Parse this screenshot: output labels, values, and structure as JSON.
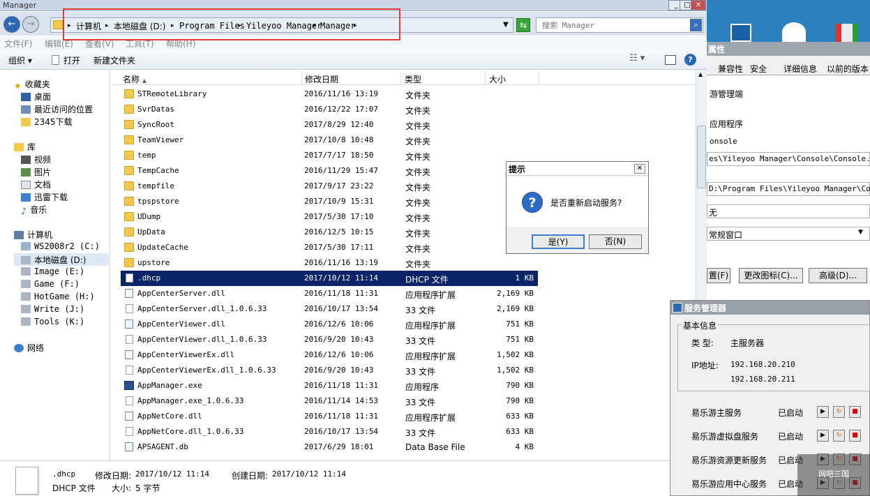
{
  "window": {
    "title": "Manager"
  },
  "address": {
    "segments": [
      "计算机",
      "本地磁盘 (D:)",
      "Program Files",
      "Yileyoo Manager",
      "Manager"
    ],
    "search_placeholder": "搜索 Manager"
  },
  "menu": [
    "文件(F)",
    "编辑(E)",
    "查看(V)",
    "工具(T)",
    "帮助(H)"
  ],
  "toolbar": {
    "organize": "组织",
    "open": "打开",
    "new_folder": "新建文件夹"
  },
  "nav": {
    "favorites": "收藏夹",
    "fav_items": [
      "桌面",
      "最近访问的位置",
      "2345下载"
    ],
    "libraries": "库",
    "lib_items": [
      "视频",
      "图片",
      "文档",
      "迅雷下载",
      "音乐"
    ],
    "computer": "计算机",
    "drives": [
      "WS2008r2 (C:)",
      "本地磁盘 (D:)",
      "Image (E:)",
      "Game (F:)",
      "HotGame (H:)",
      "Write (J:)",
      "Tools (K:)"
    ],
    "network": "网络"
  },
  "columns": {
    "name": "名称",
    "date": "修改日期",
    "type": "类型",
    "size": "大小"
  },
  "files": [
    {
      "name": "STRemoteLibrary",
      "date": "2016/11/16 13:19",
      "type": "文件夹",
      "size": "",
      "icon": "folder"
    },
    {
      "name": "SvrDatas",
      "date": "2016/12/22 17:07",
      "type": "文件夹",
      "size": "",
      "icon": "folder"
    },
    {
      "name": "SyncRoot",
      "date": "2017/8/29 12:40",
      "type": "文件夹",
      "size": "",
      "icon": "folder"
    },
    {
      "name": "TeamViewer",
      "date": "2017/10/8 10:48",
      "type": "文件夹",
      "size": "",
      "icon": "folder"
    },
    {
      "name": "temp",
      "date": "2017/7/17 18:50",
      "type": "文件夹",
      "size": "",
      "icon": "folder"
    },
    {
      "name": "TempCache",
      "date": "2016/11/29 15:47",
      "type": "文件夹",
      "size": "",
      "icon": "folder"
    },
    {
      "name": "tempfile",
      "date": "2017/9/17 23:22",
      "type": "文件夹",
      "size": "",
      "icon": "folder"
    },
    {
      "name": "tpspstore",
      "date": "2017/10/9 15:31",
      "type": "文件夹",
      "size": "",
      "icon": "folder"
    },
    {
      "name": "UDump",
      "date": "2017/5/30 17:10",
      "type": "文件夹",
      "size": "",
      "icon": "folder"
    },
    {
      "name": "UpData",
      "date": "2016/12/5 10:15",
      "type": "文件夹",
      "size": "",
      "icon": "folder"
    },
    {
      "name": "UpdateCache",
      "date": "2017/5/30 17:11",
      "type": "文件夹",
      "size": "",
      "icon": "folder"
    },
    {
      "name": "upstore",
      "date": "2016/11/16 13:19",
      "type": "文件夹",
      "size": "",
      "icon": "folder"
    },
    {
      "name": ".dhcp",
      "date": "2017/10/12 11:14",
      "type": "DHCP 文件",
      "size": "1 KB",
      "icon": "file"
    },
    {
      "name": "AppCenterServer.dll",
      "date": "2016/11/18 11:31",
      "type": "应用程序扩展",
      "size": "2,169 KB",
      "icon": "dll"
    },
    {
      "name": "AppCenterServer.dll_1.0.6.33",
      "date": "2016/10/17 13:54",
      "type": "33 文件",
      "size": "2,169 KB",
      "icon": "file"
    },
    {
      "name": "AppCenterViewer.dll",
      "date": "2016/12/6 10:06",
      "type": "应用程序扩展",
      "size": "751 KB",
      "icon": "dll"
    },
    {
      "name": "AppCenterViewer.dll_1.0.6.33",
      "date": "2016/9/20 10:43",
      "type": "33 文件",
      "size": "751 KB",
      "icon": "file"
    },
    {
      "name": "AppCenterViewerEx.dll",
      "date": "2016/12/6 10:06",
      "type": "应用程序扩展",
      "size": "1,502 KB",
      "icon": "dll"
    },
    {
      "name": "AppCenterViewerEx.dll_1.0.6.33",
      "date": "2016/9/20 10:43",
      "type": "33 文件",
      "size": "1,502 KB",
      "icon": "file"
    },
    {
      "name": "AppManager.exe",
      "date": "2016/11/18 11:31",
      "type": "应用程序",
      "size": "790 KB",
      "icon": "exe"
    },
    {
      "name": "AppManager.exe_1.0.6.33",
      "date": "2016/11/14 14:53",
      "type": "33 文件",
      "size": "790 KB",
      "icon": "file"
    },
    {
      "name": "AppNetCore.dll",
      "date": "2016/11/18 11:31",
      "type": "应用程序扩展",
      "size": "633 KB",
      "icon": "dll"
    },
    {
      "name": "AppNetCore.dll_1.0.6.33",
      "date": "2016/10/17 13:54",
      "type": "33 文件",
      "size": "633 KB",
      "icon": "file"
    },
    {
      "name": "APSAGENT.db",
      "date": "2017/6/29 18:01",
      "type": "Data Base File",
      "size": "4 KB",
      "icon": "dll"
    }
  ],
  "selected_index": 12,
  "details": {
    "name": ".dhcp",
    "type": "DHCP 文件",
    "modified_label": "修改日期:",
    "modified": "2017/10/12 11:14",
    "created_label": "创建日期:",
    "created": "2017/10/12 11:14",
    "size_label": "大小:",
    "size": "5 字节"
  },
  "dialog": {
    "title": "提示",
    "message": "是否重新启动服务?",
    "yes": "是(Y)",
    "no": "否(N)"
  },
  "props": {
    "title": "属性",
    "tabs": [
      "兼容性",
      "安全",
      "详细信息",
      "以前的版本"
    ],
    "name": "游管理端",
    "type_label": "应用程序",
    "desc": "onsole",
    "target": "es\\Yileyoo Manager\\Console\\Console.exe\"",
    "start_in": "D:\\Program Files\\Yileyoo Manager\\Conso",
    "shortcut": "无",
    "run": "常规窗口",
    "btn_open": "置(F)",
    "btn_icon": "更改图标(C)...",
    "btn_adv": "高级(D)..."
  },
  "services": {
    "title": "服务管理器",
    "group": "基本信息",
    "type_label": "类  型:",
    "type_value": "主服务器",
    "ip_label": "IP地址:",
    "ips": [
      "192.168.20.210",
      "192.168.20.211"
    ],
    "items": [
      {
        "name": "易乐游主服务",
        "status": "已启动"
      },
      {
        "name": "易乐游虚拟盘服务",
        "status": "已启动"
      },
      {
        "name": "易乐游资源更新服务",
        "status": "已启动"
      },
      {
        "name": "易乐游应用中心服务",
        "status": "已启动"
      }
    ]
  },
  "colors": {
    "selection": "#0a246a",
    "highlight_box": "#e53935",
    "desk": "#2b80c0"
  }
}
